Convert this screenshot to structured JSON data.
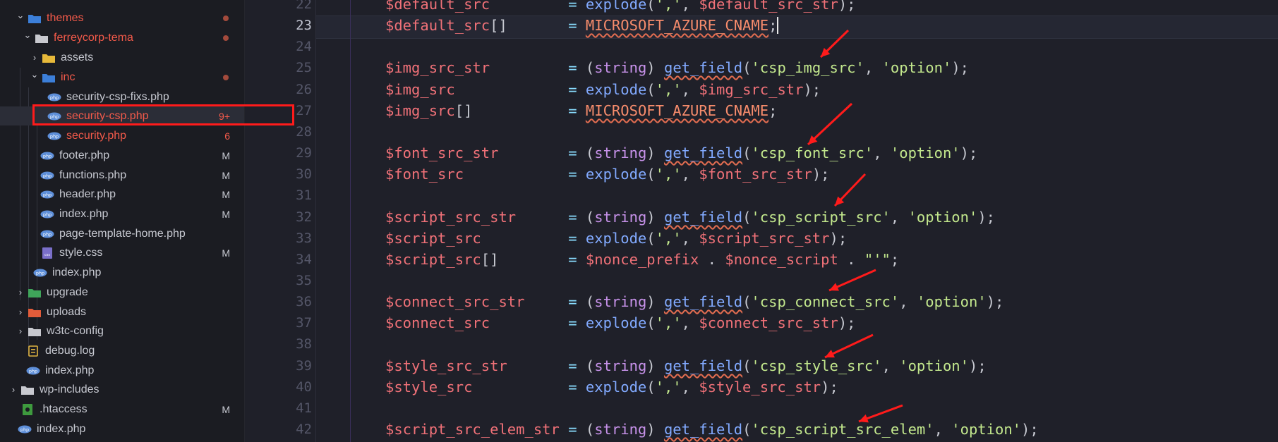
{
  "explorer": {
    "items": [
      {
        "label": "themes",
        "kind": "folder-themes",
        "chevron": "down",
        "git": "dot",
        "color": "err"
      },
      {
        "label": "ferreycorp-tema",
        "kind": "folder-open",
        "chevron": "down",
        "git": "dot",
        "color": "err"
      },
      {
        "label": "assets",
        "kind": "folder-assets",
        "chevron": "right",
        "git": "",
        "color": "normal"
      },
      {
        "label": "inc",
        "kind": "folder-inc",
        "chevron": "down",
        "git": "dot",
        "color": "err"
      },
      {
        "label": "security-csp-fixs.php",
        "kind": "php",
        "chevron": "",
        "git": "",
        "color": "normal"
      },
      {
        "label": "security-csp.php",
        "kind": "php",
        "chevron": "",
        "git": "9+",
        "color": "err"
      },
      {
        "label": "security.php",
        "kind": "php",
        "chevron": "",
        "git": "6",
        "color": "err"
      },
      {
        "label": "footer.php",
        "kind": "php",
        "chevron": "",
        "git": "M",
        "color": "normal"
      },
      {
        "label": "functions.php",
        "kind": "php",
        "chevron": "",
        "git": "M",
        "color": "normal"
      },
      {
        "label": "header.php",
        "kind": "php",
        "chevron": "",
        "git": "M",
        "color": "normal"
      },
      {
        "label": "index.php",
        "kind": "php",
        "chevron": "",
        "git": "M",
        "color": "normal"
      },
      {
        "label": "page-template-home.php",
        "kind": "php",
        "chevron": "",
        "git": "",
        "color": "normal"
      },
      {
        "label": "style.css",
        "kind": "css",
        "chevron": "",
        "git": "M",
        "color": "normal"
      },
      {
        "label": "index.php",
        "kind": "php",
        "chevron": "",
        "git": "",
        "color": "normal"
      },
      {
        "label": "upgrade",
        "kind": "folder-upgrade",
        "chevron": "right",
        "git": "",
        "color": "normal"
      },
      {
        "label": "uploads",
        "kind": "folder-uploads",
        "chevron": "right",
        "git": "",
        "color": "normal"
      },
      {
        "label": "w3tc-config",
        "kind": "folder",
        "chevron": "right",
        "git": "",
        "color": "normal"
      },
      {
        "label": "debug.log",
        "kind": "log",
        "chevron": "",
        "git": "",
        "color": "normal"
      },
      {
        "label": "index.php",
        "kind": "php",
        "chevron": "",
        "git": "",
        "color": "normal"
      },
      {
        "label": "wp-includes",
        "kind": "folder",
        "chevron": "right",
        "git": "",
        "color": "normal"
      },
      {
        "label": ".htaccess",
        "kind": "htaccess",
        "chevron": "",
        "git": "M",
        "color": "normal"
      },
      {
        "label": "index.php",
        "kind": "php",
        "chevron": "",
        "git": "",
        "color": "normal"
      }
    ],
    "selected_label": "security-csp.php",
    "colors": {
      "error": "#f45a4a",
      "highlight": "#ff1b1b"
    }
  },
  "editor": {
    "active_line": "23",
    "lines": [
      {
        "num": "22",
        "tokens": [
          [
            "v",
            "$default_src"
          ],
          [
            "p",
            "         "
          ],
          [
            "o",
            "= "
          ],
          [
            "f",
            "explode"
          ],
          [
            "p",
            "("
          ],
          [
            "s",
            "','"
          ],
          [
            "p",
            ", "
          ],
          [
            "v",
            "$default_src_str"
          ],
          [
            "p",
            ");"
          ]
        ]
      },
      {
        "num": "23",
        "tokens": [
          [
            "v",
            "$default_src"
          ],
          [
            "p",
            "[]"
          ],
          [
            "p",
            "       "
          ],
          [
            "o",
            "= "
          ],
          [
            "c",
            "MICROSOFT_AZURE_CNAME"
          ],
          [
            "p",
            ";"
          ]
        ]
      },
      {
        "num": "24",
        "tokens": []
      },
      {
        "num": "25",
        "tokens": [
          [
            "v",
            "$img_src_str"
          ],
          [
            "p",
            "         "
          ],
          [
            "o",
            "= "
          ],
          [
            "p",
            "("
          ],
          [
            "k",
            "string"
          ],
          [
            "p",
            ") "
          ],
          [
            "f",
            "get_field"
          ],
          [
            "p",
            "("
          ],
          [
            "s",
            "'csp_img_src'"
          ],
          [
            "p",
            ", "
          ],
          [
            "s",
            "'option'"
          ],
          [
            "p",
            ");"
          ]
        ]
      },
      {
        "num": "26",
        "tokens": [
          [
            "v",
            "$img_src"
          ],
          [
            "p",
            "             "
          ],
          [
            "o",
            "= "
          ],
          [
            "f",
            "explode"
          ],
          [
            "p",
            "("
          ],
          [
            "s",
            "','"
          ],
          [
            "p",
            ", "
          ],
          [
            "v",
            "$img_src_str"
          ],
          [
            "p",
            ");"
          ]
        ]
      },
      {
        "num": "27",
        "tokens": [
          [
            "v",
            "$img_src"
          ],
          [
            "p",
            "[]"
          ],
          [
            "p",
            "           "
          ],
          [
            "o",
            "= "
          ],
          [
            "c",
            "MICROSOFT_AZURE_CNAME"
          ],
          [
            "p",
            ";"
          ]
        ]
      },
      {
        "num": "28",
        "tokens": []
      },
      {
        "num": "29",
        "tokens": [
          [
            "v",
            "$font_src_str"
          ],
          [
            "p",
            "        "
          ],
          [
            "o",
            "= "
          ],
          [
            "p",
            "("
          ],
          [
            "k",
            "string"
          ],
          [
            "p",
            ") "
          ],
          [
            "f",
            "get_field"
          ],
          [
            "p",
            "("
          ],
          [
            "s",
            "'csp_font_src'"
          ],
          [
            "p",
            ", "
          ],
          [
            "s",
            "'option'"
          ],
          [
            "p",
            ");"
          ]
        ]
      },
      {
        "num": "30",
        "tokens": [
          [
            "v",
            "$font_src"
          ],
          [
            "p",
            "            "
          ],
          [
            "o",
            "= "
          ],
          [
            "f",
            "explode"
          ],
          [
            "p",
            "("
          ],
          [
            "s",
            "','"
          ],
          [
            "p",
            ", "
          ],
          [
            "v",
            "$font_src_str"
          ],
          [
            "p",
            ");"
          ]
        ]
      },
      {
        "num": "31",
        "tokens": []
      },
      {
        "num": "32",
        "tokens": [
          [
            "v",
            "$script_src_str"
          ],
          [
            "p",
            "      "
          ],
          [
            "o",
            "= "
          ],
          [
            "p",
            "("
          ],
          [
            "k",
            "string"
          ],
          [
            "p",
            ") "
          ],
          [
            "f",
            "get_field"
          ],
          [
            "p",
            "("
          ],
          [
            "s",
            "'csp_script_src'"
          ],
          [
            "p",
            ", "
          ],
          [
            "s",
            "'option'"
          ],
          [
            "p",
            ");"
          ]
        ]
      },
      {
        "num": "33",
        "tokens": [
          [
            "v",
            "$script_src"
          ],
          [
            "p",
            "          "
          ],
          [
            "o",
            "= "
          ],
          [
            "f",
            "explode"
          ],
          [
            "p",
            "("
          ],
          [
            "s",
            "','"
          ],
          [
            "p",
            ", "
          ],
          [
            "v",
            "$script_src_str"
          ],
          [
            "p",
            ");"
          ]
        ]
      },
      {
        "num": "34",
        "tokens": [
          [
            "v",
            "$script_src"
          ],
          [
            "p",
            "[]"
          ],
          [
            "p",
            "        "
          ],
          [
            "o",
            "= "
          ],
          [
            "v",
            "$nonce_prefix"
          ],
          [
            "p",
            " . "
          ],
          [
            "v",
            "$nonce_script"
          ],
          [
            "p",
            " . "
          ],
          [
            "s",
            "\"'\""
          ],
          [
            "p",
            ";"
          ]
        ]
      },
      {
        "num": "35",
        "tokens": []
      },
      {
        "num": "36",
        "tokens": [
          [
            "v",
            "$connect_src_str"
          ],
          [
            "p",
            "     "
          ],
          [
            "o",
            "= "
          ],
          [
            "p",
            "("
          ],
          [
            "k",
            "string"
          ],
          [
            "p",
            ") "
          ],
          [
            "f",
            "get_field"
          ],
          [
            "p",
            "("
          ],
          [
            "s",
            "'csp_connect_src'"
          ],
          [
            "p",
            ", "
          ],
          [
            "s",
            "'option'"
          ],
          [
            "p",
            ");"
          ]
        ]
      },
      {
        "num": "37",
        "tokens": [
          [
            "v",
            "$connect_src"
          ],
          [
            "p",
            "         "
          ],
          [
            "o",
            "= "
          ],
          [
            "f",
            "explode"
          ],
          [
            "p",
            "("
          ],
          [
            "s",
            "','"
          ],
          [
            "p",
            ", "
          ],
          [
            "v",
            "$connect_src_str"
          ],
          [
            "p",
            ");"
          ]
        ]
      },
      {
        "num": "38",
        "tokens": []
      },
      {
        "num": "39",
        "tokens": [
          [
            "v",
            "$style_src_str"
          ],
          [
            "p",
            "       "
          ],
          [
            "o",
            "= "
          ],
          [
            "p",
            "("
          ],
          [
            "k",
            "string"
          ],
          [
            "p",
            ") "
          ],
          [
            "f",
            "get_field"
          ],
          [
            "p",
            "("
          ],
          [
            "s",
            "'csp_style_src'"
          ],
          [
            "p",
            ", "
          ],
          [
            "s",
            "'option'"
          ],
          [
            "p",
            ");"
          ]
        ]
      },
      {
        "num": "40",
        "tokens": [
          [
            "v",
            "$style_src"
          ],
          [
            "p",
            "           "
          ],
          [
            "o",
            "= "
          ],
          [
            "f",
            "explode"
          ],
          [
            "p",
            "("
          ],
          [
            "s",
            "','"
          ],
          [
            "p",
            ", "
          ],
          [
            "v",
            "$style_src_str"
          ],
          [
            "p",
            ");"
          ]
        ]
      },
      {
        "num": "41",
        "tokens": []
      },
      {
        "num": "42",
        "tokens": [
          [
            "v",
            "$script_src_elem_str"
          ],
          [
            "p",
            " "
          ],
          [
            "o",
            "= "
          ],
          [
            "p",
            "("
          ],
          [
            "k",
            "string"
          ],
          [
            "p",
            ") "
          ],
          [
            "f",
            "get_field"
          ],
          [
            "p",
            "("
          ],
          [
            "s",
            "'csp_script_src_elem'"
          ],
          [
            "p",
            ", "
          ],
          [
            "s",
            "'option'"
          ],
          [
            "p",
            ");"
          ]
        ]
      }
    ]
  },
  "icons": {
    "chevron_down": "⌄",
    "chevron_right": "›"
  }
}
